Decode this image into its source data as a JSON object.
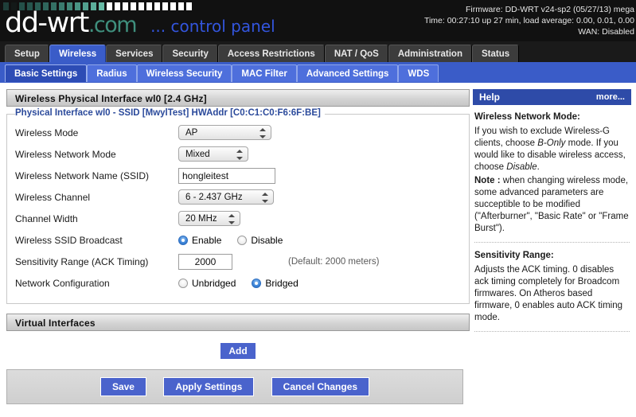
{
  "header": {
    "logo_main": "dd-wrt",
    "logo_com": ".com",
    "logo_tagline": "... control panel",
    "firmware_line": "Firmware: DD-WRT v24-sp2 (05/27/13) mega",
    "time_line": "Time: 00:27:10 up 27 min, load average: 0.00, 0.01, 0.00",
    "wan_line": "WAN: Disabled",
    "block_colors": [
      "#1f3f3a",
      "#23474128",
      "#245049",
      "#26554d",
      "#2a5d54",
      "#2f665c",
      "#347064",
      "#3a7b6e",
      "#418778",
      "#499484",
      "#52a08e",
      "#5cae9a",
      "#68bca7",
      "#ffffff",
      "#ffffff",
      "#ffffff",
      "#ffffff",
      "#ffffff",
      "#ffffff",
      "#ffffff",
      "#ffffff",
      "#ffffff",
      "#ffffff",
      "#ffffff"
    ]
  },
  "tabs": [
    {
      "label": "Setup",
      "active": false
    },
    {
      "label": "Wireless",
      "active": true
    },
    {
      "label": "Services",
      "active": false
    },
    {
      "label": "Security",
      "active": false
    },
    {
      "label": "Access Restrictions",
      "active": false
    },
    {
      "label": "NAT / QoS",
      "active": false
    },
    {
      "label": "Administration",
      "active": false
    },
    {
      "label": "Status",
      "active": false
    }
  ],
  "subtabs": [
    {
      "label": "Basic Settings",
      "active": true
    },
    {
      "label": "Radius",
      "active": false
    },
    {
      "label": "Wireless Security",
      "active": false
    },
    {
      "label": "MAC Filter",
      "active": false
    },
    {
      "label": "Advanced Settings",
      "active": false
    },
    {
      "label": "WDS",
      "active": false
    }
  ],
  "main": {
    "section_title": "Wireless Physical Interface wl0 [2.4 GHz]",
    "legend": "Physical Interface wl0 - SSID [MwylTest] HWAddr [C0:C1:C0:F6:6F:BE]",
    "rows": {
      "wireless_mode": {
        "label": "Wireless Mode",
        "value": "AP"
      },
      "network_mode": {
        "label": "Wireless Network Mode",
        "value": "Mixed"
      },
      "ssid": {
        "label": "Wireless Network Name (SSID)",
        "value": "hongleitest"
      },
      "channel": {
        "label": "Wireless Channel",
        "value": "6 - 2.437 GHz"
      },
      "channel_width": {
        "label": "Channel Width",
        "value": "20 MHz"
      },
      "ssid_broadcast": {
        "label": "Wireless SSID Broadcast",
        "options": [
          {
            "label": "Enable",
            "selected": true
          },
          {
            "label": "Disable",
            "selected": false
          }
        ]
      },
      "sensitivity": {
        "label": "Sensitivity Range (ACK Timing)",
        "value": "2000",
        "hint": "(Default: 2000 meters)"
      },
      "network_config": {
        "label": "Network Configuration",
        "options": [
          {
            "label": "Unbridged",
            "selected": false
          },
          {
            "label": "Bridged",
            "selected": true
          }
        ]
      }
    },
    "virtual_interfaces_title": "Virtual Interfaces",
    "add_button": "Add"
  },
  "footer": {
    "save": "Save",
    "apply": "Apply Settings",
    "cancel": "Cancel Changes"
  },
  "help": {
    "title": "Help",
    "more": "more...",
    "section1_title": "Wireless Network Mode:",
    "section1_p1_a": "If you wish to exclude Wireless-G clients, choose ",
    "section1_p1_em1": "B-Only",
    "section1_p1_b": " mode. If you would like to disable wireless access, choose ",
    "section1_p1_em2": "Disable",
    "section1_p1_c": ".",
    "section1_note_label": "Note :",
    "section1_note_text": " when changing wireless mode, some advanced parameters are succeptible to be modified (\"Afterburner\", \"Basic Rate\" or \"Frame Burst\").",
    "section2_title": "Sensitivity Range:",
    "section2_text": "Adjusts the ACK timing. 0 disables ack timing completely for Broadcom firmwares. On Atheros based firmware, 0 enables auto ACK timing mode."
  }
}
